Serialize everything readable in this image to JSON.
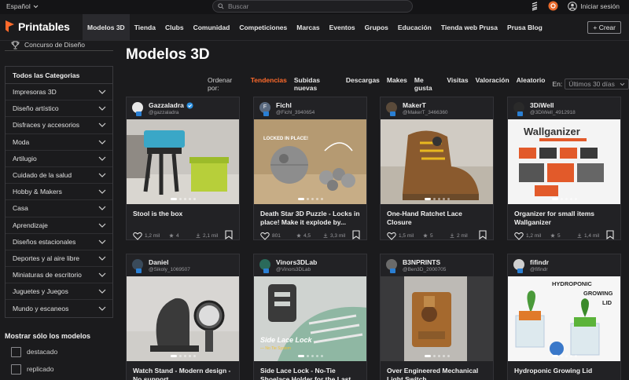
{
  "topbar": {
    "language": "Español",
    "search_placeholder": "Buscar",
    "login": "Iniciar sesión"
  },
  "nav": {
    "logo": "Printables",
    "links": [
      "Modelos 3D",
      "Tienda",
      "Clubs",
      "Comunidad",
      "Competiciones",
      "Marcas",
      "Eventos",
      "Grupos",
      "Educación",
      "Tienda web Prusa",
      "Prusa Blog"
    ],
    "active_index": 0,
    "create": "+ Crear"
  },
  "sidebar": {
    "contest": "Concurso de Diseño",
    "categories_title": "Todos las Categorias",
    "categories": [
      "Impresoras 3D",
      "Diseño artístico",
      "Disfraces y accesorios",
      "Moda",
      "Artilugio",
      "Cuidado de la salud",
      "Hobby & Makers",
      "Casa",
      "Aprendizaje",
      "Diseños estacionales",
      "Deportes y al aire libre",
      "Miniaturas de escritorio",
      "Juguetes y Juegos",
      "Mundo y escaneos"
    ],
    "filter_title": "Mostrar sólo los modelos",
    "filters": [
      "destacado",
      "replicado"
    ]
  },
  "main": {
    "title": "Modelos 3D",
    "sort_label": "Ordenar por:",
    "sort_options": [
      "Tendencias",
      "Subidas nuevas",
      "Descargas",
      "Makes",
      "Me gusta",
      "Visitas",
      "Valoración",
      "Aleatorio"
    ],
    "sort_active_index": 0,
    "period_label": "En:",
    "period_value": "Últimos 30 días"
  },
  "colors": {
    "accent": "#ff6a2b",
    "background": "#1b1b1d",
    "card": "#222225",
    "badge_blue": "#2a7fd4"
  },
  "cards": [
    {
      "author": "Gazzaladra",
      "handle": "@gazzaladra",
      "verified": true,
      "avatar_letter": "",
      "title": "Stool is the box",
      "likes": "1,2 mil",
      "rating": "4",
      "downloads": "2,1 mil",
      "image_overlay": ""
    },
    {
      "author": "Fichl",
      "handle": "@Fichl_3940654",
      "verified": false,
      "avatar_letter": "F",
      "title": "Death Star 3D Puzzle - Locks in place! Make it explode by...",
      "likes": "801",
      "rating": "4,5",
      "downloads": "3,3 mil",
      "image_overlay": "LOCKED IN PLACE!"
    },
    {
      "author": "MakerT",
      "handle": "@MakerT_3466360",
      "verified": false,
      "avatar_letter": "",
      "title": "One-Hand Ratchet Lace Closure",
      "likes": "1,5 mil",
      "rating": "5",
      "downloads": "2 mil",
      "image_overlay": ""
    },
    {
      "author": "3DiWell",
      "handle": "@3DiWell_4912918",
      "verified": false,
      "avatar_letter": "",
      "title": "Organizer for small items Wallganizer",
      "likes": "1,2 mil",
      "rating": "5",
      "downloads": "1,4 mil",
      "image_overlay": "Wallganizer"
    },
    {
      "author": "Daniel",
      "handle": "@Sikoly_1069507",
      "verified": false,
      "avatar_letter": "",
      "title": "Watch Stand - Modern design - No support",
      "likes": "",
      "rating": "",
      "downloads": "",
      "image_overlay": ""
    },
    {
      "author": "Vinors3DLab",
      "handle": "@Vinors3DLab",
      "verified": false,
      "avatar_letter": "",
      "title": "Side Lace Lock - No-Tie Shoelace Holder for the Last...",
      "likes": "",
      "rating": "",
      "downloads": "",
      "image_overlay": "Side Lace Lock"
    },
    {
      "author": "B3NPRINTS",
      "handle": "@Ben3D_2000705",
      "verified": false,
      "avatar_letter": "",
      "title": "Over Engineered Mechanical Light Switch",
      "likes": "",
      "rating": "",
      "downloads": "",
      "image_overlay": ""
    },
    {
      "author": "fifindr",
      "handle": "@fifindr",
      "verified": false,
      "avatar_letter": "",
      "title": "Hydroponic Growing Lid",
      "likes": "",
      "rating": "",
      "downloads": "",
      "image_overlay": "HYDROPONIC GROWING LID"
    }
  ]
}
